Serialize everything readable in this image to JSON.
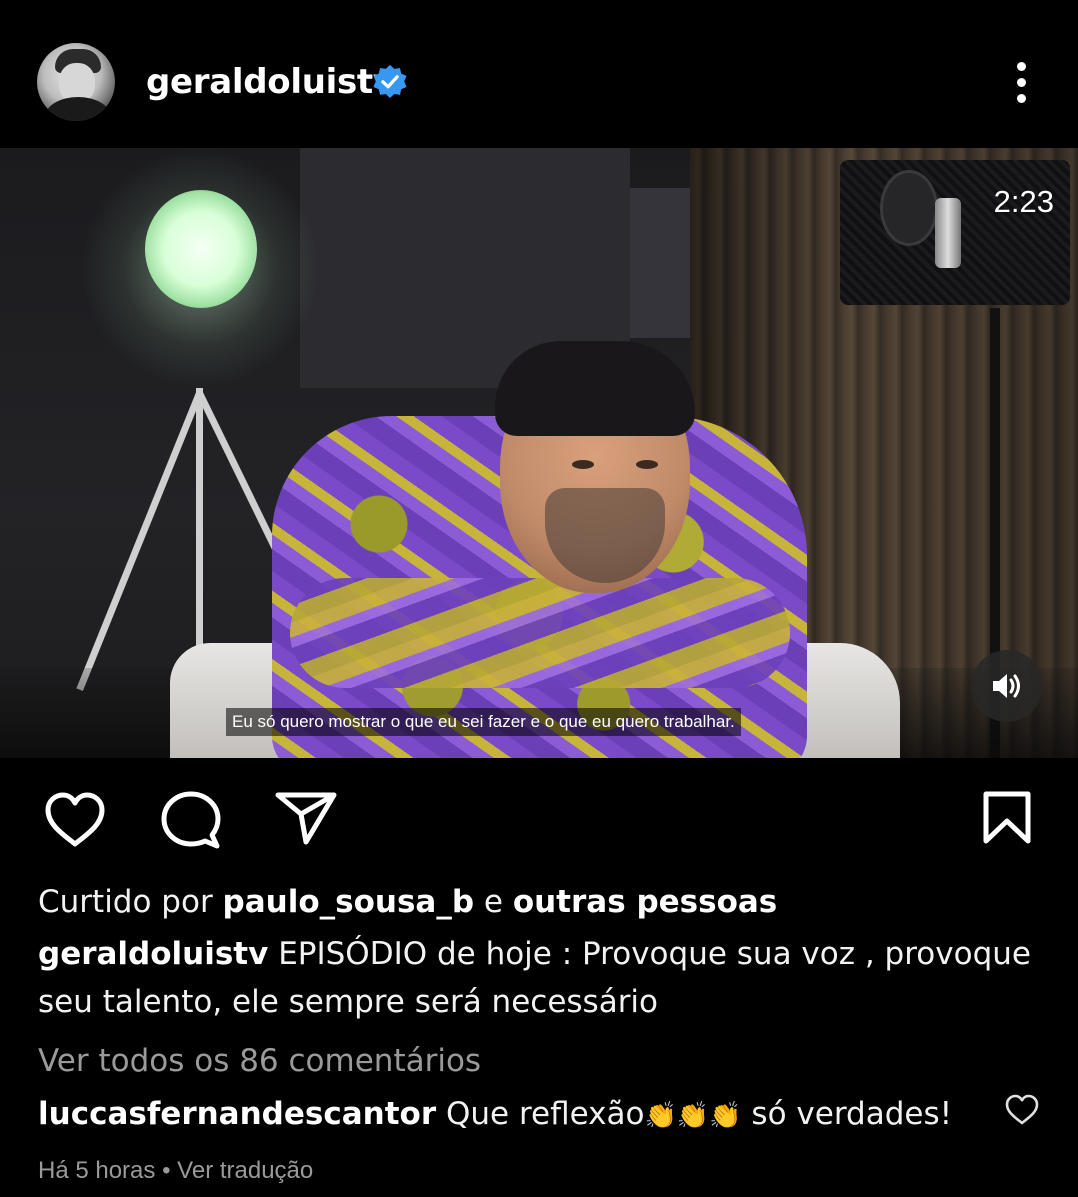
{
  "post": {
    "username": "geraldoluistv",
    "verified": true,
    "more_icon": "more-vertical-icon",
    "video": {
      "duration": "2:23",
      "subtitle": "Eu só quero mostrar o que eu sei fazer e o que eu quero trabalhar.",
      "sound_icon": "volume-on-icon"
    },
    "actions": {
      "like_icon": "heart-icon",
      "comment_icon": "comment-bubble-icon",
      "share_icon": "send-icon",
      "save_icon": "bookmark-icon"
    },
    "likes": {
      "prefix": "Curtido por ",
      "user": "paulo_sousa_b",
      "connector": " e ",
      "others": "outras pessoas"
    },
    "caption": {
      "username": "geraldoluistv",
      "text": " EPISÓDIO de hoje : Provoque sua voz , provoque seu talento, ele sempre será necessário"
    },
    "view_all_comments": "Ver todos os 86 comentários",
    "top_comment": {
      "username": "luccasfernandescantor",
      "text_before": " Que reflexão",
      "emoji": "👏👏👏",
      "text_after": " só verdades!"
    },
    "meta": {
      "time": "Há 5 horas",
      "separator": " • ",
      "translate": "Ver tradução"
    }
  },
  "colors": {
    "background": "#000000",
    "verified_badge": "#3897f0",
    "muted_text": "#9a9a9a"
  }
}
